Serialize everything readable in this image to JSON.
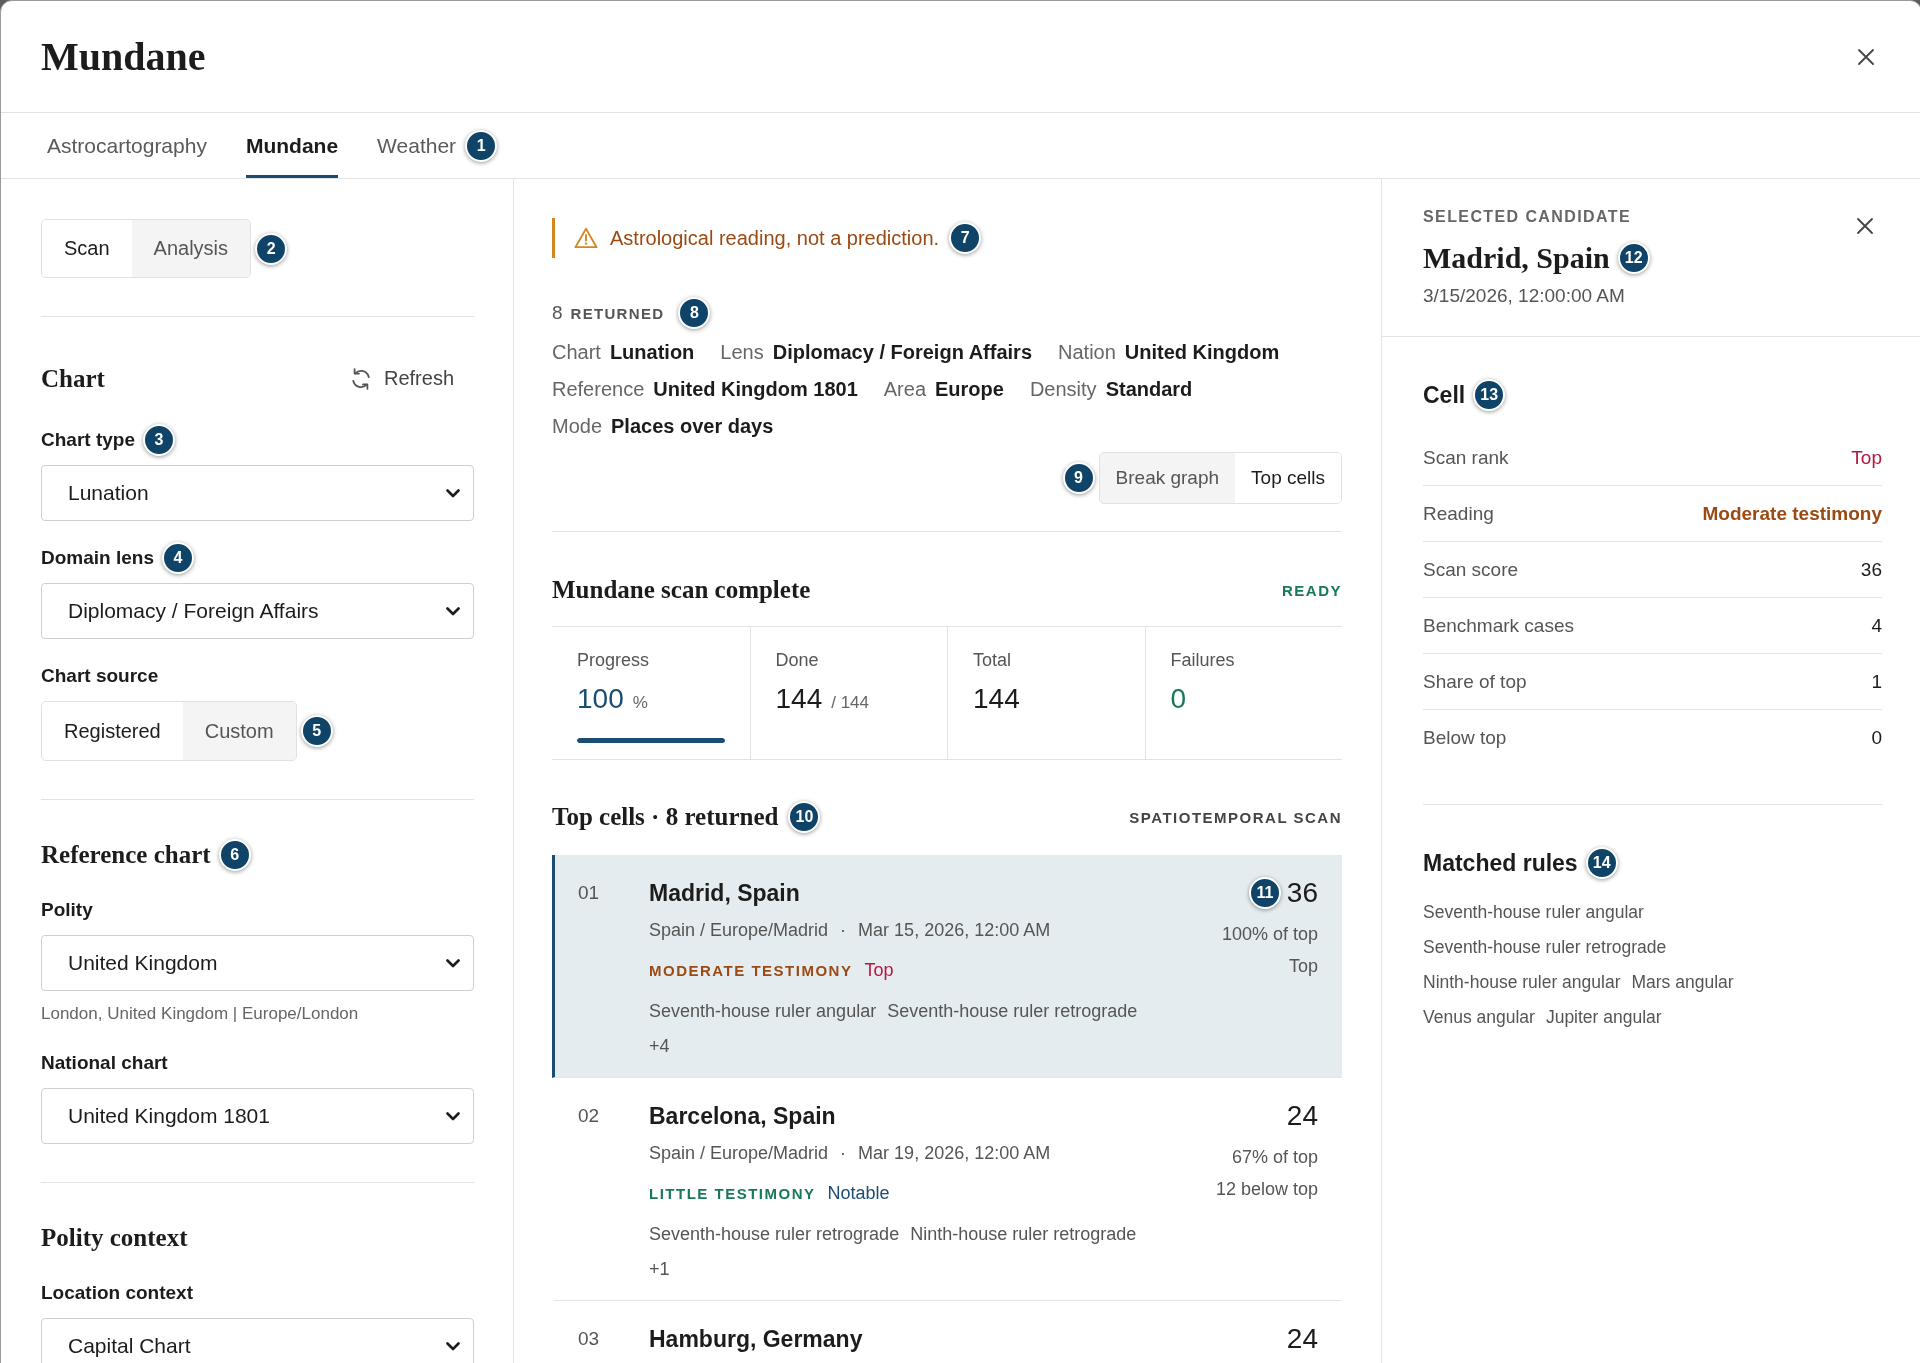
{
  "dialog": {
    "title": "Mundane"
  },
  "tabs": [
    {
      "label": "Astrocartography",
      "selected": false
    },
    {
      "label": "Mundane",
      "selected": true
    },
    {
      "label": "Weather",
      "selected": false,
      "callout": "1"
    }
  ],
  "sidebar": {
    "mode_switch": {
      "segments": [
        {
          "label": "Scan",
          "selected": true
        },
        {
          "label": "Analysis",
          "selected": false
        }
      ],
      "callout": "2"
    },
    "sections": [
      {
        "title": "Chart",
        "action": "Refresh",
        "fields": [
          {
            "kind": "select",
            "label": "Chart type",
            "value": "Lunation",
            "callout": "3"
          },
          {
            "kind": "select",
            "label": "Domain lens",
            "value": "Diplomacy / Foreign Affairs",
            "callout": "4"
          },
          {
            "kind": "segmented",
            "label": "Chart source",
            "segments": [
              {
                "label": "Registered",
                "selected": true
              },
              {
                "label": "Custom",
                "selected": false
              }
            ],
            "callout": "5"
          }
        ]
      },
      {
        "title": "Reference chart",
        "callout": "6",
        "fields": [
          {
            "kind": "select",
            "label": "Polity",
            "value": "United Kingdom",
            "hint": "London, United Kingdom | Europe/London"
          },
          {
            "kind": "select",
            "label": "National chart",
            "value": "United Kingdom 1801"
          }
        ]
      },
      {
        "title": "Polity context",
        "fields": [
          {
            "kind": "select",
            "label": "Location context",
            "value": "Capital Chart"
          }
        ]
      }
    ]
  },
  "scan": {
    "notice": {
      "text": "Astrological reading, not a prediction.",
      "callout": "7"
    },
    "summary": {
      "count": "8",
      "label": "RETURNED",
      "callout": "8"
    },
    "meta": [
      {
        "label": "Chart",
        "value": "Lunation"
      },
      {
        "label": "Lens",
        "value": "Diplomacy / Foreign Affairs"
      },
      {
        "label": "Nation",
        "value": "United Kingdom"
      },
      {
        "label": "Reference",
        "value": "United Kingdom 1801"
      },
      {
        "label": "Area",
        "value": "Europe"
      },
      {
        "label": "Density",
        "value": "Standard"
      },
      {
        "label": "Mode",
        "value": "Places over days"
      }
    ],
    "view_switch": {
      "segments": [
        {
          "label": "Break graph",
          "selected": false
        },
        {
          "label": "Top cells",
          "selected": true
        }
      ],
      "callout": "9"
    },
    "status": {
      "title": "Mundane scan complete",
      "badge": "READY",
      "color": "#17785a"
    },
    "stats": [
      {
        "label": "Progress",
        "value": "100",
        "unit": "%",
        "color": "#1b4d72",
        "level": 1
      },
      {
        "label": "Done",
        "value": "144",
        "unit": "/ 144",
        "color": "#1c1c1c"
      },
      {
        "label": "Total",
        "value": "144",
        "color": "#1c1c1c"
      },
      {
        "label": "Failures",
        "value": "0",
        "color": "#17785a"
      }
    ],
    "results": {
      "title": "Top cells · 8 returned",
      "callout": "10",
      "caption": "SPATIOTEMPORAL SCAN",
      "rows": [
        {
          "rank": "01",
          "name": "Madrid, Spain",
          "place": "Spain / Europe/Madrid",
          "separator": "·",
          "date": "Mar 15, 2026, 12:00 AM",
          "reading": {
            "label": "MODERATE TESTIMONY",
            "color": "#9a4a12"
          },
          "tier": {
            "label": "Top",
            "color": "#b3173f"
          },
          "rules": [
            "Seventh-house ruler angular",
            "Seventh-house ruler retrograde"
          ],
          "more": "+4",
          "score": "36",
          "share": "100% of top",
          "standing": "Top",
          "selected": true,
          "callout": "11"
        },
        {
          "rank": "02",
          "name": "Barcelona, Spain",
          "place": "Spain / Europe/Madrid",
          "separator": "·",
          "date": "Mar 19, 2026, 12:00 AM",
          "reading": {
            "label": "LITTLE TESTIMONY",
            "color": "#17785a"
          },
          "tier": {
            "label": "Notable",
            "color": "#1b4d72"
          },
          "rules": [
            "Seventh-house ruler retrograde",
            "Ninth-house ruler retrograde"
          ],
          "more": "+1",
          "score": "24",
          "share": "67% of top",
          "standing": "12 below top",
          "selected": false
        },
        {
          "rank": "03",
          "name": "Hamburg, Germany",
          "score": "24",
          "selected": false
        }
      ]
    }
  },
  "detail": {
    "eyebrow": "SELECTED CANDIDATE",
    "title": "Madrid, Spain",
    "callout": "12",
    "subtitle": "3/15/2026, 12:00:00 AM",
    "cell": {
      "title": "Cell",
      "callout": "13",
      "rows": [
        {
          "label": "Scan rank",
          "value": "Top",
          "color": "#b3173f",
          "strong": false
        },
        {
          "label": "Reading",
          "value": "Moderate testimony",
          "color": "#9a4a12",
          "strong": true
        },
        {
          "label": "Scan score",
          "value": "36",
          "color": "#1c1c1c",
          "strong": false
        },
        {
          "label": "Benchmark cases",
          "value": "4",
          "color": "#1c1c1c",
          "strong": false
        },
        {
          "label": "Share of top",
          "value": "1",
          "color": "#1c1c1c",
          "strong": false
        },
        {
          "label": "Below top",
          "value": "0",
          "color": "#1c1c1c",
          "strong": false
        }
      ]
    },
    "matched_rules": {
      "title": "Matched rules",
      "callout": "14",
      "items": [
        "Seventh-house ruler angular",
        "Seventh-house ruler retrograde",
        "Ninth-house ruler angular",
        "Mars angular",
        "Venus angular",
        "Jupiter angular"
      ]
    }
  }
}
